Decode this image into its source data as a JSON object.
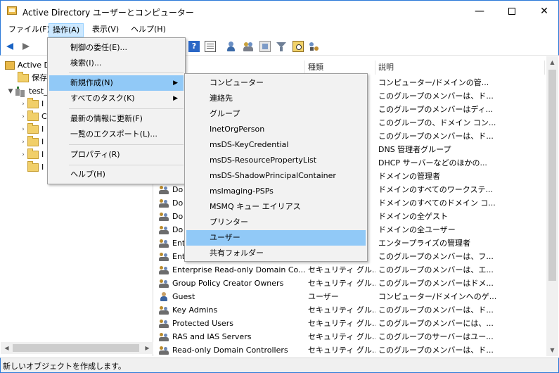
{
  "window": {
    "title": "Active Directory ユーザーとコンピューター",
    "minimize_glyph": "—",
    "close_glyph": "✕"
  },
  "menubar": [
    {
      "label": "ファイル(F)"
    },
    {
      "label": "操作(A)"
    },
    {
      "label": "表示(V)"
    },
    {
      "label": "ヘルプ(H)"
    }
  ],
  "tree": {
    "root_label": "Active D",
    "saved_queries": "保存",
    "domain": "test_",
    "expand_glyph": "▼",
    "collapse_glyph": "›",
    "child_letters": [
      "I",
      "C",
      "I",
      "I",
      "I",
      "I"
    ]
  },
  "columns": {
    "name": "",
    "type": "種類",
    "description": "説明"
  },
  "rows_top": [
    {
      "type": "",
      "description": "コンピューター/ドメインの管..."
    },
    {
      "type": "",
      "description": "このグループのメンバーは、ド..."
    },
    {
      "type": "",
      "description": "このグループのメンバーはディ..."
    },
    {
      "type": "",
      "description": "このグループの、ドメイン コン..."
    },
    {
      "type": "",
      "description": "このグループのメンバーは、ド..."
    },
    {
      "type": "",
      "description": "DNS 管理者グループ"
    },
    {
      "type": "",
      "description": "DHCP サーバーなどのほかの..."
    },
    {
      "type": "",
      "description": "ドメインの管理者"
    },
    {
      "type": "",
      "name": "Do",
      "description": "ドメインのすべてのワークステ..."
    },
    {
      "type": "",
      "name": "Do",
      "description": "ドメインのすべてのドメイン コ..."
    },
    {
      "type": "",
      "name": "Do",
      "description": "ドメインの全ゲスト"
    },
    {
      "type": "",
      "name": "Do",
      "description": "ドメインの全ユーザー"
    },
    {
      "type": "",
      "name": "Ent",
      "description": "エンタープライズの管理者"
    },
    {
      "type": "",
      "name": "Ent",
      "description": "このグループのメンバーは、フ..."
    }
  ],
  "rows_bottom": [
    {
      "icon": "group",
      "name": "Enterprise Read-only Domain Co...",
      "type": "セキュリティ グル...",
      "description": "このグループのメンバーは、エ..."
    },
    {
      "icon": "group",
      "name": "Group Policy Creator Owners",
      "type": "セキュリティ グル...",
      "description": "このグループのメンバーはドメ..."
    },
    {
      "icon": "user",
      "name": "Guest",
      "type": "ユーザー",
      "description": "コンピューター/ドメインへのゲ..."
    },
    {
      "icon": "group",
      "name": "Key Admins",
      "type": "セキュリティ グル...",
      "description": "このグループのメンバーは、ド..."
    },
    {
      "icon": "group",
      "name": "Protected Users",
      "type": "セキュリティ グル...",
      "description": "このグループのメンバーには、..."
    },
    {
      "icon": "group",
      "name": "RAS and IAS Servers",
      "type": "セキュリティ グル...",
      "description": "このグループのサーバーはユー..."
    },
    {
      "icon": "group",
      "name": "Read-only Domain Controllers",
      "type": "セキュリティ グル...",
      "description": "このグループのメンバーは、ド..."
    }
  ],
  "action_menu": {
    "items": [
      {
        "label": "制御の委任(E)...",
        "submenu": false
      },
      {
        "label": "検索(I)...",
        "submenu": false
      },
      {
        "label": "新規作成(N)",
        "submenu": true
      },
      {
        "label": "すべてのタスク(K)",
        "submenu": true
      },
      {
        "label": "最新の情報に更新(F)",
        "submenu": false
      },
      {
        "label": "一覧のエクスポート(L)...",
        "submenu": false
      },
      {
        "label": "プロパティ(R)",
        "submenu": false
      },
      {
        "label": "ヘルプ(H)",
        "submenu": false
      }
    ],
    "submenu_arrow": "▶"
  },
  "new_submenu": {
    "items": [
      {
        "label": "コンピューター"
      },
      {
        "label": "連絡先"
      },
      {
        "label": "グループ"
      },
      {
        "label": "InetOrgPerson"
      },
      {
        "label": "msDS-KeyCredential"
      },
      {
        "label": "msDS-ResourcePropertyList"
      },
      {
        "label": "msDS-ShadowPrincipalContainer"
      },
      {
        "label": "msImaging-PSPs"
      },
      {
        "label": "MSMQ キュー エイリアス"
      },
      {
        "label": "プリンター"
      },
      {
        "label": "ユーザー"
      },
      {
        "label": "共有フォルダー"
      }
    ],
    "highlighted": "ユーザー"
  },
  "scroll": {
    "up": "▲",
    "down": "▼",
    "left": "◀",
    "right": "▶"
  },
  "status": {
    "text": "新しいオブジェクトを作成します。"
  },
  "toolbar": {
    "help_glyph": "?"
  },
  "colors": {
    "accent": "#2b79d8",
    "menu_highlight": "#91c9f7",
    "menubar_active": "#cce8ff"
  }
}
